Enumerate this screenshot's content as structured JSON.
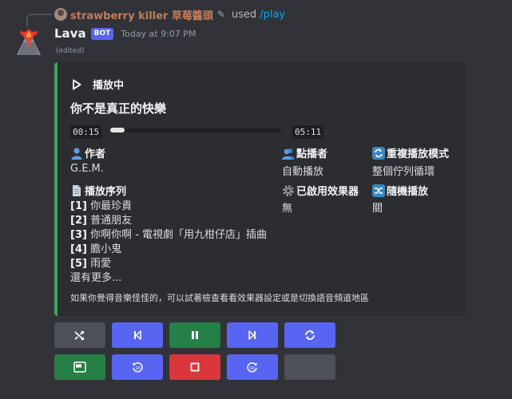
{
  "reply": {
    "username": "strawberry killer 草莓醬頭",
    "used_text": "used",
    "command": "/play"
  },
  "message": {
    "author": "Lava",
    "bot_tag": "BOT",
    "timestamp": "Today at 9:07 PM",
    "edited": "(edited)"
  },
  "embed": {
    "accent_color": "#3ba55d",
    "author_text": "播放中",
    "title": "你不是真正的快樂",
    "time_current": "00:15",
    "time_total": "05:11",
    "progress": 0.05,
    "fields": {
      "artist": {
        "name": "作者",
        "value": "G.E.M.",
        "icon": "bust-icon"
      },
      "requester": {
        "name": "點播者",
        "value": "自動播放",
        "icon": "busts-icon"
      },
      "repeat": {
        "name": "重複播放模式",
        "value": "整個佇列循環",
        "icon": "repeat-icon"
      },
      "queue": {
        "name": "播放序列",
        "icon": "page-icon"
      },
      "filters": {
        "name": "已啟用效果器",
        "value": "無",
        "icon": "gear-icon"
      },
      "shuffle": {
        "name": "隨機播放",
        "value": "關",
        "icon": "shuffle-icon"
      }
    },
    "queue_items": [
      {
        "index": "[1]",
        "title": "你最珍貴"
      },
      {
        "index": "[2]",
        "title": "普通朋友"
      },
      {
        "index": "[3]",
        "title": "你啊你啊 - 電視劇「用九柑仔店」插曲"
      },
      {
        "index": "[4]",
        "title": "膽小鬼"
      },
      {
        "index": "[5]",
        "title": "雨愛"
      }
    ],
    "queue_more": "還有更多...",
    "footer": "如果你覺得音樂怪怪的，可以試著檢查看看效果器設定或是切換語音頻道地區"
  },
  "buttons": [
    {
      "icon": "shuffle-icon",
      "color": "#4e5058"
    },
    {
      "icon": "previous-icon",
      "color": "#5865f2"
    },
    {
      "icon": "pause-icon",
      "color": "#248046"
    },
    {
      "icon": "next-icon",
      "color": "#5865f2"
    },
    {
      "icon": "repeat-icon",
      "color": "#5865f2"
    },
    {
      "icon": "autoplay-icon",
      "color": "#248046"
    },
    {
      "icon": "rewind-icon",
      "color": "#5865f2"
    },
    {
      "icon": "stop-icon",
      "color": "#da373c"
    },
    {
      "icon": "forward-icon",
      "color": "#5865f2"
    },
    {
      "icon": "blank-icon",
      "color": "#4e5058"
    }
  ]
}
